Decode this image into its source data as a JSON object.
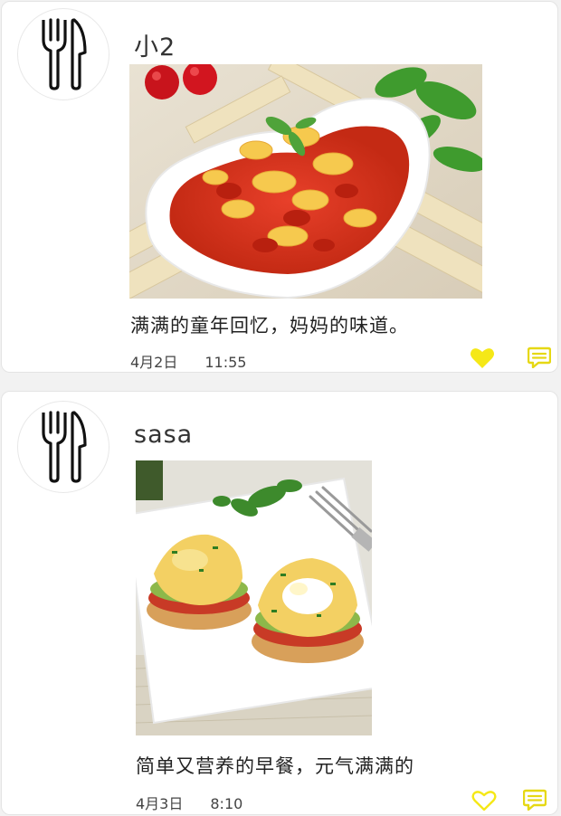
{
  "posts": [
    {
      "username": "小2",
      "caption": "满满的童年回忆，妈妈的味道。",
      "date": "4月2日",
      "time": "11:55",
      "liked": true,
      "avatar_icon": "fork-knife-icon",
      "photo_subject": "tomato-egg-dish-photo"
    },
    {
      "username": "sasa",
      "caption": "简单又营养的早餐，元气满满的",
      "date": "4月3日",
      "time": "8:10",
      "liked": false,
      "avatar_icon": "fork-knife-icon",
      "photo_subject": "eggs-benedict-photo"
    }
  ],
  "colors": {
    "accent": "#f5e817",
    "background": "#f2f2f2",
    "card": "#ffffff"
  }
}
